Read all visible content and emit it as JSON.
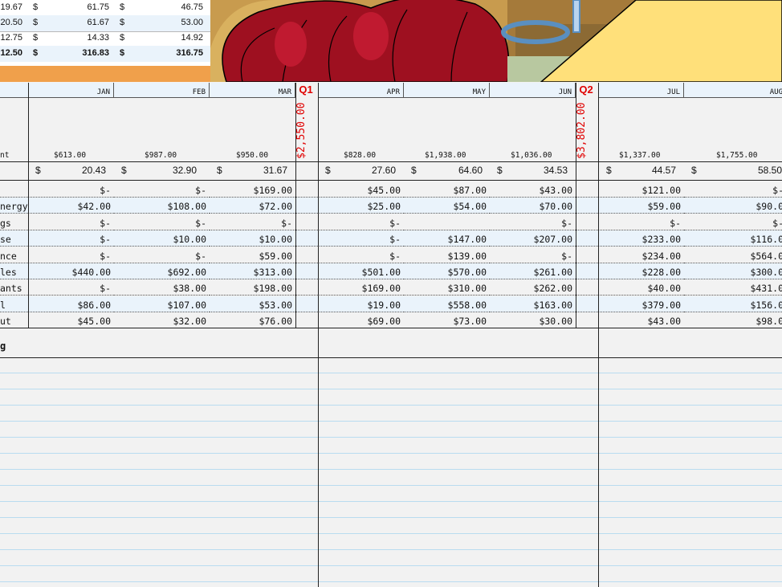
{
  "summary": {
    "rows": [
      {
        "c1": "19.67",
        "c2": "61.75",
        "c3": "46.75"
      },
      {
        "c1": "20.50",
        "c2": "61.67",
        "c3": "53.00"
      },
      {
        "c1": "12.75",
        "c2": "14.33",
        "c3": "14.92"
      },
      {
        "c1": "12.50",
        "c2": "316.83",
        "c3": "316.75"
      }
    ],
    "currency": "$"
  },
  "months": [
    "JAN",
    "FEB",
    "MAR",
    "APR",
    "MAY",
    "JUN",
    "JUL",
    "AUG"
  ],
  "quarters": [
    {
      "label": "Q1",
      "total": "$2,550.00"
    },
    {
      "label": "Q2",
      "total": "$3,802.00"
    }
  ],
  "month_totals": [
    "$613.00",
    "$987.00",
    "$950.00",
    "$828.00",
    "$1,938.00",
    "$1,036.00",
    "$1,337.00",
    "$1,755.00"
  ],
  "row_label_partial": "nt",
  "averages": [
    "20.43",
    "32.90",
    "31.67",
    "27.60",
    "64.60",
    "34.53",
    "44.57",
    "58.50"
  ],
  "categories": [
    {
      "label": "",
      "values": [
        "$-",
        "$-",
        "$169.00",
        "$45.00",
        "$87.00",
        "$43.00",
        "$121.00",
        "$-"
      ]
    },
    {
      "label": "nergy",
      "values": [
        "$42.00",
        "$108.00",
        "$72.00",
        "$25.00",
        "$54.00",
        "$70.00",
        "$59.00",
        "$90.0"
      ]
    },
    {
      "label": "gs",
      "values": [
        "$-",
        "$-",
        "$-",
        "$-",
        "",
        "$-",
        "$-",
        "$-"
      ]
    },
    {
      "label": "se",
      "values": [
        "$-",
        "$10.00",
        "$10.00",
        "$-",
        "$147.00",
        "$207.00",
        "$233.00",
        "$116.0"
      ]
    },
    {
      "label": "nce",
      "values": [
        "$-",
        "$-",
        "$59.00",
        "$-",
        "$139.00",
        "$-",
        "$234.00",
        "$564.0"
      ]
    },
    {
      "label": "les",
      "values": [
        "$440.00",
        "$692.00",
        "$313.00",
        "$501.00",
        "$570.00",
        "$261.00",
        "$228.00",
        "$300.0"
      ]
    },
    {
      "label": "ants",
      "values": [
        "$-",
        "$38.00",
        "$198.00",
        "$169.00",
        "$310.00",
        "$262.00",
        "$40.00",
        "$431.0"
      ]
    },
    {
      "label": "l",
      "values": [
        "$86.00",
        "$107.00",
        "$53.00",
        "$19.00",
        "$558.00",
        "$163.00",
        "$379.00",
        "$156.0"
      ]
    },
    {
      "label": "ut",
      "values": [
        "$45.00",
        "$32.00",
        "$76.00",
        "$69.00",
        "$73.00",
        "$30.00",
        "$43.00",
        "$98.0"
      ]
    }
  ],
  "notes_label": "g",
  "colors": {
    "accent_red": "#e00000",
    "orange": "#f0a04b",
    "row_blue": "#eaf3fb",
    "note_line": "#b9dcf0"
  }
}
